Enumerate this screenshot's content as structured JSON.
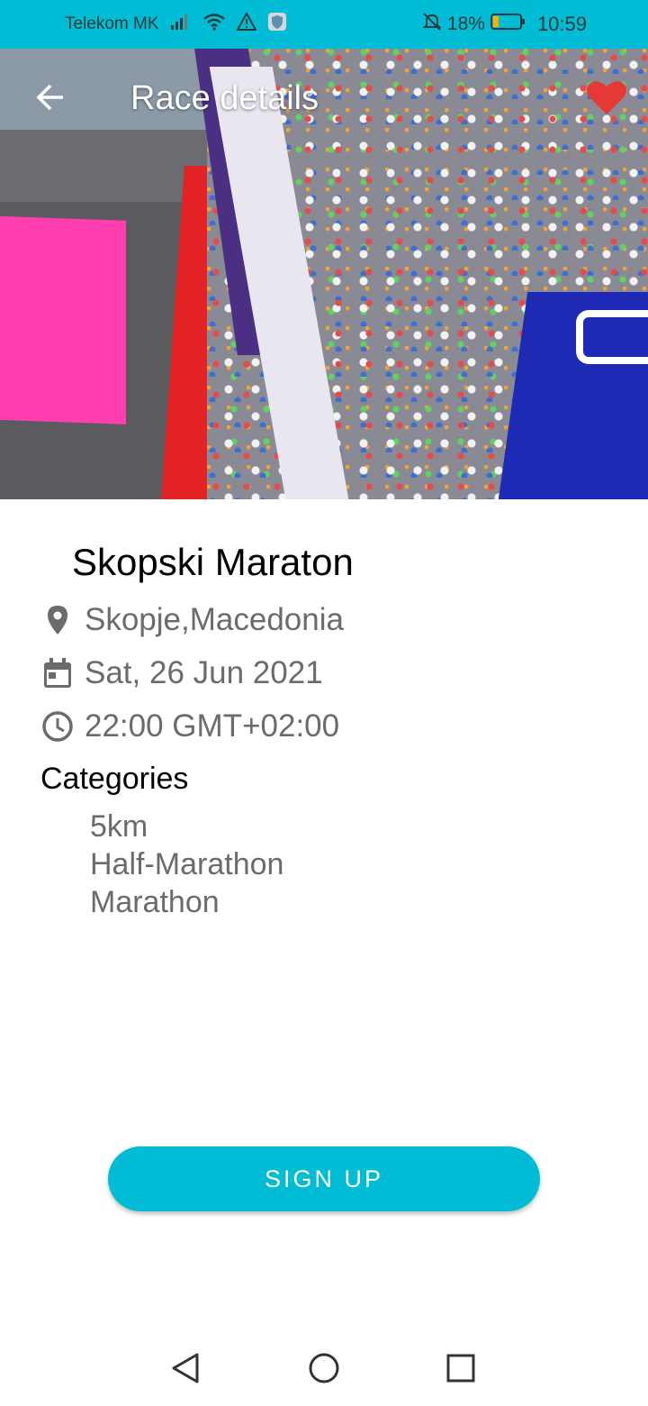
{
  "status_bar": {
    "carrier": "Telekom MK",
    "battery_percent": "18%",
    "time": "10:59",
    "icons": [
      "signal-icon",
      "wifi-icon",
      "warning-icon",
      "shield-app-icon",
      "bell-off-icon",
      "battery-icon"
    ]
  },
  "app_bar": {
    "title": "Race details",
    "back_icon": "arrow-left-icon",
    "favorite_icon": "heart-icon",
    "favorite_color": "#e53935"
  },
  "race": {
    "name": "Skopski Maraton",
    "location": "Skopje,Macedonia",
    "date": "Sat, 26 Jun 2021",
    "time": "22:00 GMT+02:00",
    "categories_title": "Categories",
    "categories": [
      "5km",
      "Half-Marathon",
      "Marathon"
    ]
  },
  "actions": {
    "signup_label": "SIGN UP"
  },
  "colors": {
    "accent": "#00bcd4",
    "secondary_text": "#6b6b6b"
  }
}
